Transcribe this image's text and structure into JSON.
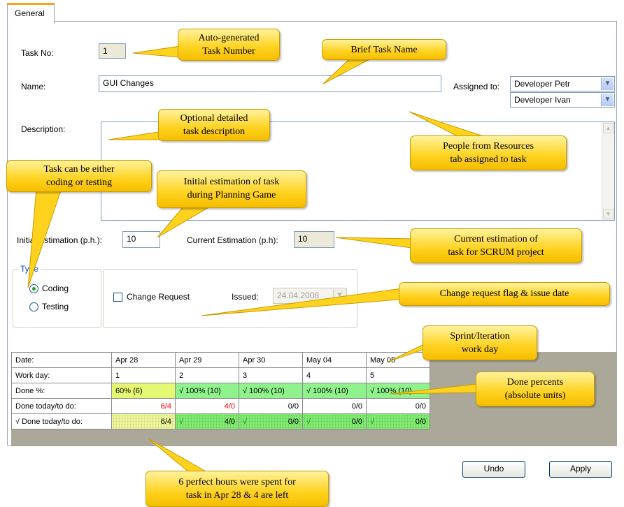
{
  "tabs": [
    {
      "label": "General"
    }
  ],
  "form": {
    "task_no_label": "Task No:",
    "task_no_value": "1",
    "name_label": "Name:",
    "name_value": "GUI Changes",
    "assigned_label": "Assigned to:",
    "assigned": [
      "Developer Petr",
      "Developer Ivan"
    ],
    "description_label": "Description:",
    "description_value": "",
    "initial_est_label": "Initial Estimation (p.h.):",
    "initial_est_value": "10",
    "current_est_label": "Current Estimation (p.h):",
    "current_est_value": "10",
    "type_legend": "Type",
    "type_options": [
      "Coding",
      "Testing"
    ],
    "type_selected": "Coding",
    "change_request_label": "Change Request",
    "change_request_checked": false,
    "issued_label": "Issued:",
    "issued_value": "24.04.2008"
  },
  "grid": {
    "row_labels": [
      "Date:",
      "Work day:",
      "Done %:",
      "Done today/to do:",
      "√ Done today/to do:"
    ],
    "columns": [
      {
        "date": "Apr 28",
        "workday": "1",
        "done_pct": "60% (6)",
        "today": "6/4",
        "today_done": "6/4"
      },
      {
        "date": "Apr 29",
        "workday": "2",
        "done_pct": "√ 100% (10)",
        "today": "4/0",
        "today_done": "4/0"
      },
      {
        "date": "Apr 30",
        "workday": "3",
        "done_pct": "√ 100% (10)",
        "today": "0/0",
        "today_done": "0/0"
      },
      {
        "date": "May 04",
        "workday": "4",
        "done_pct": "√ 100% (10)",
        "today": "0/0",
        "today_done": "0/0"
      },
      {
        "date": "May 05",
        "workday": "5",
        "done_pct": "√ 100% (10)",
        "today": "0/0",
        "today_done": "0/0"
      }
    ]
  },
  "buttons": {
    "undo": "Undo",
    "apply": "Apply"
  },
  "callouts": {
    "auto_task_no": [
      "Auto-generated",
      "Task Number"
    ],
    "brief_name": [
      "Brief Task Name"
    ],
    "optional_desc": [
      "Optional detailed",
      "task description"
    ],
    "people": [
      "People from Resources",
      "tab assigned to task"
    ],
    "type": [
      "Task can be either",
      "coding or testing"
    ],
    "initial_est": [
      "Initial estimation of task",
      "during Planning Game"
    ],
    "current_est": [
      "Current estimation of",
      "task for SCRUM project"
    ],
    "change_req": [
      "Change request flag & issue date"
    ],
    "sprint": [
      "Sprint/Iteration",
      "work day"
    ],
    "done_pct": [
      "Done percents",
      "(absolute units)"
    ],
    "perfect_hours": [
      "6 perfect hours were spent for",
      "task in Apr 28 & 4 are left"
    ]
  },
  "colors": {
    "callout": "#ffd21e",
    "done_partial": "#e6f773",
    "done_full": "#8ff28c",
    "overrun": "#ff0000",
    "tab_accent": "#f3a521"
  }
}
